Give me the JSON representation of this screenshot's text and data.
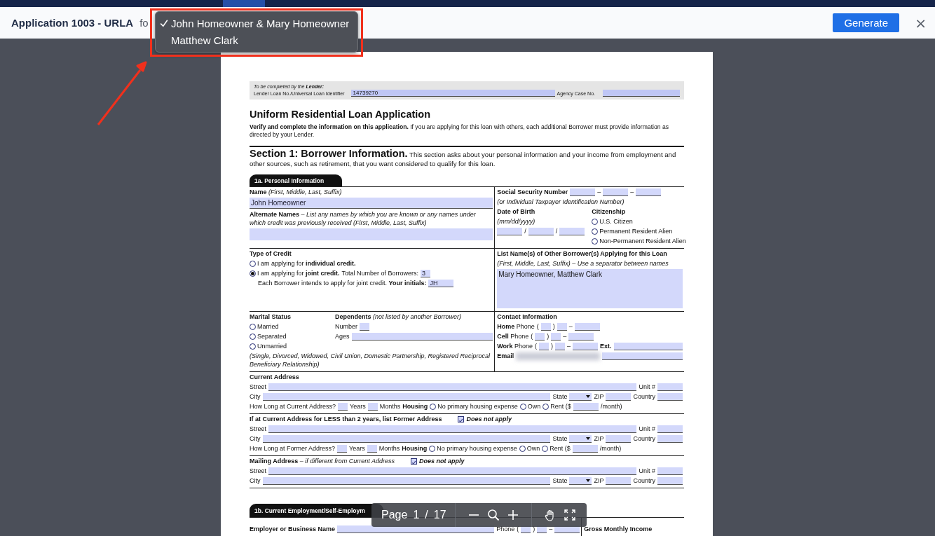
{
  "header": {
    "title": "Application 1003 - URLA",
    "for_label": "fo",
    "generate_button": "Generate",
    "close_button": "×"
  },
  "borrower_menu": {
    "items": [
      {
        "label": "John Homeowner & Mary Homeowner",
        "selected": true
      },
      {
        "label": "Matthew Clark",
        "selected": false
      }
    ]
  },
  "document": {
    "lender_note": "To be completed by the **Lender:**",
    "loan_id_label": "Lender Loan No./Universal Loan Identifier",
    "loan_id": "14739270",
    "agency_label": "Agency Case No.",
    "title": "Uniform Residential Loan Application",
    "intro": "**Verify and complete the information on this application.** If you are applying for this loan with others, each additional Borrower must provide information as directed by your Lender.",
    "section_intro": "**Section 1: Borrower Information.** This section asks about your personal information and your income from employment and other sources, such as retirement, that you want considered to qualify for this loan.",
    "parts": [
      {
        "tab": "1a. Personal Information",
        "blocks": [
          {
            "columns": [
              {
                "rows": [
                  {
                    "items": [
                      {
                        "kind": "text",
                        "text": "**Name** *(First, Middle, Last, Suffix)*"
                      }
                    ]
                  },
                  {
                    "items": [
                      {
                        "kind": "field",
                        "value": "John Homeowner"
                      }
                    ]
                  },
                  {
                    "items": [
                      {
                        "kind": "text",
                        "text": "**Alternate Names** *– List any names by which you are known or any names under which credit was previously received  (First, Middle, Last, Suffix)*"
                      }
                    ]
                  },
                  {
                    "items": [
                      {
                        "kind": "box"
                      }
                    ]
                  }
                ]
              },
              {
                "rows": [
                  {
                    "items": [
                      {
                        "kind": "text",
                        "text": "**Social Security Number**"
                      },
                      {
                        "kind": "mid_field"
                      },
                      {
                        "kind": "text",
                        "text": "–"
                      },
                      {
                        "kind": "mid_field"
                      },
                      {
                        "kind": "text",
                        "text": "–"
                      },
                      {
                        "kind": "mid_field"
                      }
                    ]
                  },
                  {
                    "items": [
                      {
                        "kind": "note",
                        "text": "(or Individual Taxpayer Identification Number)"
                      }
                    ]
                  },
                  {
                    "items": [
                      {
                        "kind": "columns",
                        "columns": [
                          {
                            "rows": [
                              {
                                "items": [
                                  {
                                    "kind": "text",
                                    "text": "**Date of Birth**"
                                  }
                                ]
                              },
                              {
                                "items": [
                                  {
                                    "kind": "note",
                                    "text": "(mm/dd/yyyy)"
                                  }
                                ]
                              },
                              {
                                "items": [
                                  {
                                    "kind": "mid_field"
                                  },
                                  {
                                    "kind": "text",
                                    "text": "/"
                                  },
                                  {
                                    "kind": "mid_field"
                                  },
                                  {
                                    "kind": "text",
                                    "text": "/"
                                  },
                                  {
                                    "kind": "mid_field"
                                  }
                                ]
                              }
                            ]
                          },
                          {
                            "rows": [
                              {
                                "items": [
                                  {
                                    "kind": "text",
                                    "text": "**Citizenship**"
                                  }
                                ]
                              },
                              {
                                "items": [
                                  {
                                    "kind": "radio",
                                    "label": "U.S. Citizen",
                                    "selected": false
                                  }
                                ]
                              },
                              {
                                "items": [
                                  {
                                    "kind": "radio",
                                    "label": "Permanent Resident Alien",
                                    "selected": false
                                  }
                                ]
                              },
                              {
                                "items": [
                                  {
                                    "kind": "radio",
                                    "label": "Non-Permanent Resident Alien",
                                    "selected": false
                                  }
                                ]
                              }
                            ]
                          }
                        ]
                      }
                    ]
                  }
                ]
              }
            ]
          },
          {
            "columns": [
              {
                "rows": [
                  {
                    "items": [
                      {
                        "kind": "text",
                        "text": "**Type of Credit**"
                      }
                    ]
                  },
                  {
                    "items": [
                      {
                        "kind": "radio",
                        "label": "I am applying for **individual credit.**",
                        "selected": false
                      }
                    ]
                  },
                  {
                    "items": [
                      {
                        "kind": "radio",
                        "label": "I am applying for **joint credit.**",
                        "selected": true
                      },
                      {
                        "kind": "text",
                        "text": "Total Number of Borrowers:"
                      },
                      {
                        "kind": "short_field",
                        "value": "3"
                      }
                    ]
                  },
                  {
                    "items": [
                      {
                        "kind": "text",
                        "text": "Each Borrower intends to apply for joint credit. **Your initials:**"
                      },
                      {
                        "kind": "mid_field",
                        "value": "JH"
                      }
                    ]
                  }
                ]
              },
              {
                "rows": [
                  {
                    "items": [
                      {
                        "kind": "text",
                        "text": "**List Name(s) of Other Borrower(s) Applying for this Loan**"
                      }
                    ]
                  },
                  {
                    "items": [
                      {
                        "kind": "note",
                        "text": "(First, Middle, Last, Suffix) – Use a separator between names"
                      }
                    ]
                  },
                  {
                    "items": [
                      {
                        "kind": "box",
                        "value": "Mary Homeowner, Matthew Clark"
                      }
                    ]
                  }
                ]
              }
            ]
          },
          {
            "columns": [
              {
                "rows": [
                  {
                    "items": [
                      {
                        "kind": "columns",
                        "columns": [
                          {
                            "rows": [
                              {
                                "items": [
                                  {
                                    "kind": "text",
                                    "text": "**Marital Status**"
                                  }
                                ]
                              },
                              {
                                "items": [
                                  {
                                    "kind": "radio",
                                    "label": "Married",
                                    "selected": false
                                  }
                                ]
                              },
                              {
                                "items": [
                                  {
                                    "kind": "radio",
                                    "label": "Separated",
                                    "selected": false
                                  }
                                ]
                              },
                              {
                                "items": [
                                  {
                                    "kind": "radio",
                                    "label": "Unmarried",
                                    "selected": false
                                  }
                                ]
                              }
                            ]
                          },
                          {
                            "rows": [
                              {
                                "items": [
                                  {
                                    "kind": "text",
                                    "text": "**Dependents** *(not listed by another Borrower)*"
                                  }
                                ]
                              },
                              {
                                "items": [
                                  {
                                    "kind": "text",
                                    "text": "Number"
                                  },
                                  {
                                    "kind": "short_field"
                                  }
                                ]
                              },
                              {
                                "items": [
                                  {
                                    "kind": "text",
                                    "text": "Ages"
                                  },
                                  {
                                    "kind": "field"
                                  }
                                ]
                              }
                            ]
                          }
                        ]
                      }
                    ]
                  },
                  {
                    "items": [
                      {
                        "kind": "note",
                        "text": "(Single, Divorced, Widowed, Civil Union, Domestic Partnership, Registered Reciprocal Beneficiary Relationship)"
                      }
                    ]
                  }
                ]
              },
              {
                "rows": [
                  {
                    "items": [
                      {
                        "kind": "text",
                        "text": "**Contact Information**"
                      }
                    ]
                  },
                  {
                    "items": [
                      {
                        "kind": "text",
                        "text": "**Home** Phone"
                      },
                      {
                        "kind": "text",
                        "text": "("
                      },
                      {
                        "kind": "short_field"
                      },
                      {
                        "kind": "text",
                        "text": ")"
                      },
                      {
                        "kind": "short_field"
                      },
                      {
                        "kind": "text",
                        "text": "–"
                      },
                      {
                        "kind": "mid_field"
                      }
                    ]
                  },
                  {
                    "items": [
                      {
                        "kind": "text",
                        "text": "**Cell** Phone"
                      },
                      {
                        "kind": "text",
                        "text": "("
                      },
                      {
                        "kind": "short_field"
                      },
                      {
                        "kind": "text",
                        "text": ")"
                      },
                      {
                        "kind": "short_field"
                      },
                      {
                        "kind": "text",
                        "text": "–"
                      },
                      {
                        "kind": "mid_field"
                      }
                    ]
                  },
                  {
                    "items": [
                      {
                        "kind": "text",
                        "text": "**Work** Phone"
                      },
                      {
                        "kind": "text",
                        "text": "("
                      },
                      {
                        "kind": "short_field"
                      },
                      {
                        "kind": "text",
                        "text": ")"
                      },
                      {
                        "kind": "short_field"
                      },
                      {
                        "kind": "text",
                        "text": "–"
                      },
                      {
                        "kind": "mid_field"
                      },
                      {
                        "kind": "text",
                        "text": "**Ext.**"
                      },
                      {
                        "kind": "field"
                      }
                    ]
                  },
                  {
                    "items": [
                      {
                        "kind": "text",
                        "text": "**Email**"
                      },
                      {
                        "kind": "redacted"
                      },
                      {
                        "kind": "field"
                      }
                    ]
                  }
                ]
              }
            ]
          },
          {
            "columns": [
              {
                "rows": [
                  {
                    "items": [
                      {
                        "kind": "text",
                        "text": "**Current Address**"
                      }
                    ]
                  },
                  {
                    "items": [
                      {
                        "kind": "text",
                        "text": "Street"
                      },
                      {
                        "kind": "field"
                      },
                      {
                        "kind": "text",
                        "text": "Unit #"
                      },
                      {
                        "kind": "mid_field"
                      }
                    ]
                  },
                  {
                    "items": [
                      {
                        "kind": "text",
                        "text": "City"
                      },
                      {
                        "kind": "field"
                      },
                      {
                        "kind": "text",
                        "text": "State"
                      },
                      {
                        "kind": "select"
                      },
                      {
                        "kind": "text",
                        "text": "ZIP"
                      },
                      {
                        "kind": "mid_field"
                      },
                      {
                        "kind": "text",
                        "text": "Country"
                      },
                      {
                        "kind": "mid_field"
                      }
                    ]
                  },
                  {
                    "items": [
                      {
                        "kind": "text",
                        "text": "How Long at Current Address?"
                      },
                      {
                        "kind": "short_field"
                      },
                      {
                        "kind": "text",
                        "text": "Years"
                      },
                      {
                        "kind": "short_field"
                      },
                      {
                        "kind": "text",
                        "text": "Months"
                      },
                      {
                        "kind": "text",
                        "text": "**Housing**"
                      },
                      {
                        "kind": "radio",
                        "label": "No primary housing expense",
                        "selected": false
                      },
                      {
                        "kind": "radio",
                        "label": "Own",
                        "selected": false
                      },
                      {
                        "kind": "radio",
                        "label": "Rent ($",
                        "selected": false
                      },
                      {
                        "kind": "mid_field"
                      },
                      {
                        "kind": "text",
                        "text": "/month)"
                      }
                    ]
                  }
                ]
              }
            ]
          },
          {
            "columns": [
              {
                "rows": [
                  {
                    "items": [
                      {
                        "kind": "text",
                        "text": "**If at Current Address for LESS than 2 years, list Former Address**"
                      },
                      {
                        "kind": "checkbox",
                        "label": "Does not apply",
                        "checked": true
                      }
                    ]
                  },
                  {
                    "items": [
                      {
                        "kind": "text",
                        "text": "Street"
                      },
                      {
                        "kind": "field"
                      },
                      {
                        "kind": "text",
                        "text": "Unit #"
                      },
                      {
                        "kind": "mid_field"
                      }
                    ]
                  },
                  {
                    "items": [
                      {
                        "kind": "text",
                        "text": "City"
                      },
                      {
                        "kind": "field"
                      },
                      {
                        "kind": "text",
                        "text": "State"
                      },
                      {
                        "kind": "select"
                      },
                      {
                        "kind": "text",
                        "text": "ZIP"
                      },
                      {
                        "kind": "mid_field"
                      },
                      {
                        "kind": "text",
                        "text": "Country"
                      },
                      {
                        "kind": "mid_field"
                      }
                    ]
                  },
                  {
                    "items": [
                      {
                        "kind": "text",
                        "text": "How Long at Former Address?"
                      },
                      {
                        "kind": "short_field"
                      },
                      {
                        "kind": "text",
                        "text": "Years"
                      },
                      {
                        "kind": "short_field"
                      },
                      {
                        "kind": "text",
                        "text": "Months"
                      },
                      {
                        "kind": "text",
                        "text": "**Housing**"
                      },
                      {
                        "kind": "radio",
                        "label": "No primary housing expense",
                        "selected": false
                      },
                      {
                        "kind": "radio",
                        "label": "Own",
                        "selected": false
                      },
                      {
                        "kind": "radio",
                        "label": "Rent ($",
                        "selected": false
                      },
                      {
                        "kind": "mid_field"
                      },
                      {
                        "kind": "text",
                        "text": "/month)"
                      }
                    ]
                  }
                ]
              }
            ]
          },
          {
            "columns": [
              {
                "rows": [
                  {
                    "items": [
                      {
                        "kind": "text",
                        "text": "**Mailing Address** *– if different from Current Address*"
                      },
                      {
                        "kind": "checkbox",
                        "label": "Does not apply",
                        "checked": true
                      }
                    ]
                  },
                  {
                    "items": [
                      {
                        "kind": "text",
                        "text": "Street"
                      },
                      {
                        "kind": "field"
                      },
                      {
                        "kind": "text",
                        "text": "Unit #"
                      },
                      {
                        "kind": "mid_field"
                      }
                    ]
                  },
                  {
                    "items": [
                      {
                        "kind": "text",
                        "text": "City"
                      },
                      {
                        "kind": "field"
                      },
                      {
                        "kind": "text",
                        "text": "State"
                      },
                      {
                        "kind": "select"
                      },
                      {
                        "kind": "text",
                        "text": "ZIP"
                      },
                      {
                        "kind": "mid_field"
                      },
                      {
                        "kind": "text",
                        "text": "Country"
                      },
                      {
                        "kind": "mid_field"
                      }
                    ]
                  }
                ]
              }
            ]
          }
        ]
      },
      {
        "tab": "1b. Current Employment/Self-Employm",
        "blocks": [
          {
            "columns": [
              {
                "rows": [
                  {
                    "items": [
                      {
                        "kind": "text",
                        "text": "**Employer or Business Name**"
                      },
                      {
                        "kind": "field"
                      },
                      {
                        "kind": "text",
                        "text": "Phone"
                      },
                      {
                        "kind": "text",
                        "text": "("
                      },
                      {
                        "kind": "short_field"
                      },
                      {
                        "kind": "text",
                        "text": ")"
                      },
                      {
                        "kind": "short_field"
                      },
                      {
                        "kind": "text",
                        "text": "–"
                      },
                      {
                        "kind": "mid_field"
                      }
                    ]
                  }
                ]
              },
              {
                "rows": [
                  {
                    "items": [
                      {
                        "kind": "text",
                        "text": "**Gross Monthly Income**"
                      }
                    ]
                  }
                ]
              }
            ]
          }
        ]
      }
    ]
  },
  "viewer_toolbar": {
    "page_label": "Page",
    "page": "1",
    "separator": "/",
    "total": "17"
  }
}
